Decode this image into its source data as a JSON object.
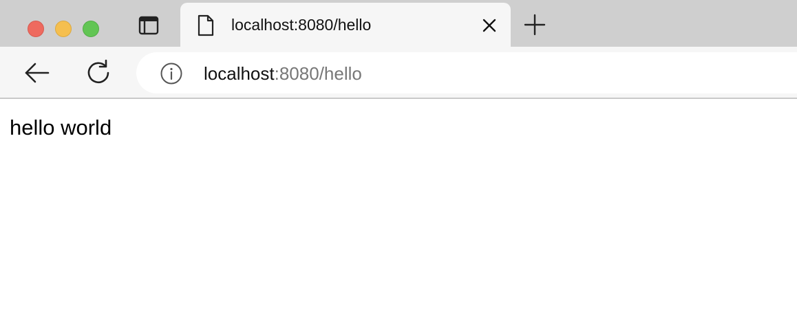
{
  "window": {
    "controls": [
      "close",
      "minimize",
      "maximize"
    ]
  },
  "tab": {
    "title": "localhost:8080/hello",
    "icon": "document-icon",
    "close_icon": "close-icon"
  },
  "toolbar": {
    "back_icon": "back-arrow-icon",
    "reload_icon": "reload-icon",
    "site_info_icon": "info-icon"
  },
  "address_bar": {
    "host": "localhost",
    "rest": ":8080/hello"
  },
  "page": {
    "body_text": "hello world"
  },
  "colors": {
    "tabbar_bg": "#cfcfcf",
    "toolbar_bg": "#f6f6f6",
    "close_light": "#ee6a5f",
    "minimize_light": "#f5bf4f",
    "maximize_light": "#62c554",
    "url_secondary": "#777777"
  }
}
